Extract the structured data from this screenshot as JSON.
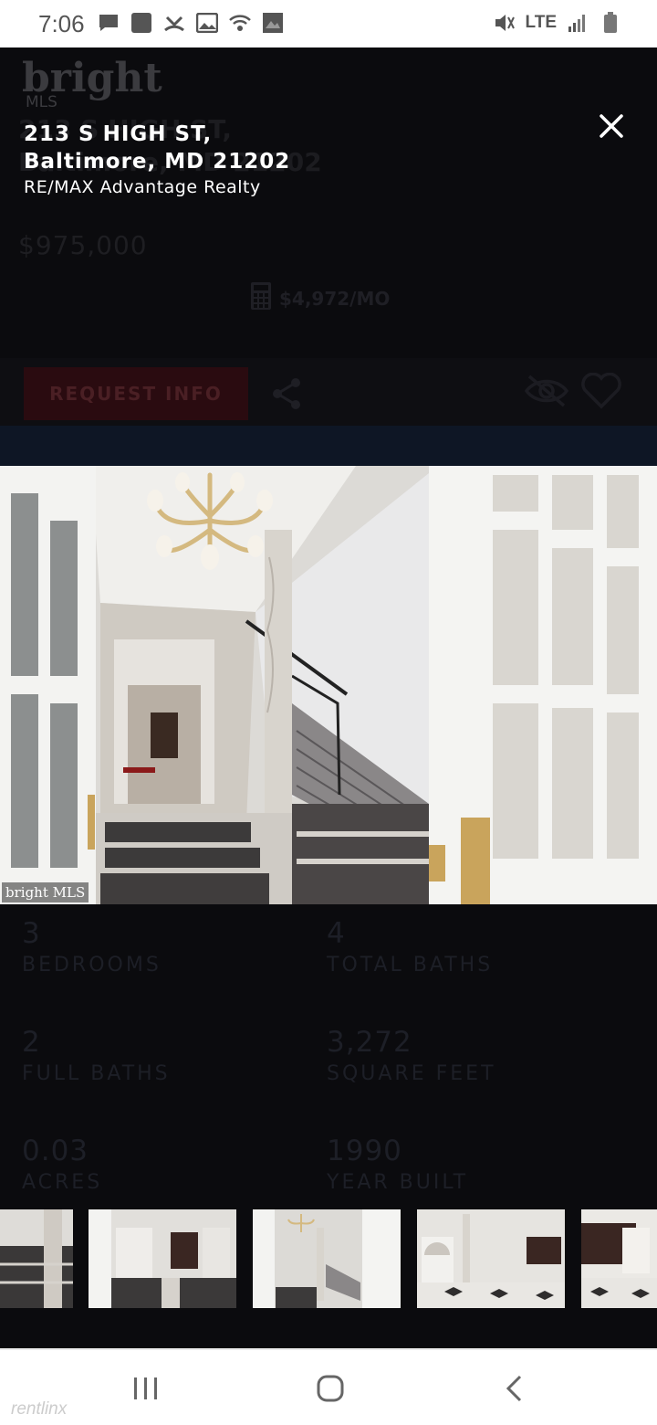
{
  "status_bar": {
    "time": "7:06",
    "network": "LTE",
    "left_icons": [
      "message-icon",
      "square-app-icon",
      "missed-call-icon",
      "gallery-icon",
      "wifi-calling-icon",
      "image-icon"
    ],
    "right_icons": [
      "mute-vibrate-icon",
      "signal-icon",
      "battery-icon"
    ]
  },
  "background_page": {
    "logo": "bright",
    "logo_sub": "MLS",
    "price": "$975,000",
    "mortgage": "$4,972/MO",
    "request_button": "REQUEST INFO",
    "stats": [
      {
        "value": "3",
        "label": "BEDROOMS"
      },
      {
        "value": "4",
        "label": "TOTAL BATHS"
      },
      {
        "value": "2",
        "label": "FULL BATHS"
      },
      {
        "value": "3,272",
        "label": "SQUARE FEET"
      },
      {
        "value": "0.03",
        "label": "ACRES"
      },
      {
        "value": "1990",
        "label": "YEAR BUILT"
      }
    ]
  },
  "lightbox": {
    "address_line1": "213 S HIGH ST,",
    "address_line2": "Baltimore, MD 21202",
    "agency": "RE/MAX Advantage Realty",
    "photo_watermark": "bright MLS",
    "thumbnail_count": 5
  },
  "nav_bar": {
    "buttons": [
      "recent-apps",
      "home",
      "back"
    ]
  },
  "footer_watermark": "rentlinx"
}
